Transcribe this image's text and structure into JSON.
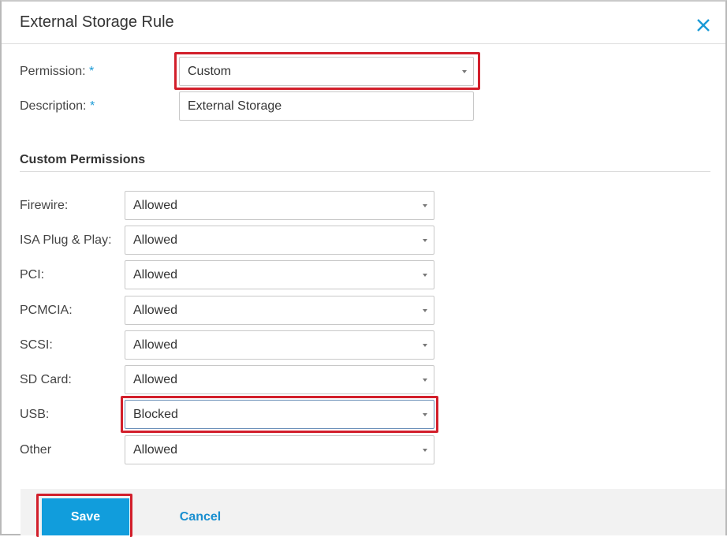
{
  "dialog": {
    "title": "External Storage Rule",
    "close_icon": "close-icon"
  },
  "form": {
    "permission": {
      "label": "Permission:",
      "required_mark": "*",
      "value": "Custom"
    },
    "description": {
      "label": "Description:",
      "required_mark": "*",
      "value": "External Storage"
    }
  },
  "custom_permissions": {
    "title": "Custom Permissions",
    "items": [
      {
        "label": "Firewire:",
        "value": "Allowed"
      },
      {
        "label": "ISA Plug & Play:",
        "value": "Allowed"
      },
      {
        "label": "PCI:",
        "value": "Allowed"
      },
      {
        "label": "PCMCIA:",
        "value": "Allowed"
      },
      {
        "label": "SCSI:",
        "value": "Allowed"
      },
      {
        "label": "SD Card:",
        "value": "Allowed"
      },
      {
        "label": "USB:",
        "value": "Blocked"
      },
      {
        "label": "Other",
        "value": "Allowed"
      }
    ]
  },
  "footer": {
    "save_label": "Save",
    "cancel_label": "Cancel"
  },
  "colors": {
    "accent": "#119ddc",
    "highlight": "#d21f2b",
    "required": "#1a9ad6"
  }
}
